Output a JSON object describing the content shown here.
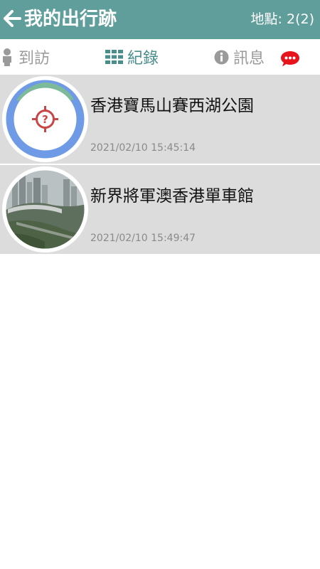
{
  "header": {
    "title": "我的出行跡",
    "count_text": "地點: 2(2)"
  },
  "tabs": [
    {
      "label": "到訪",
      "icon": "person-icon",
      "active": false
    },
    {
      "label": "紀錄",
      "icon": "grid-icon",
      "active": true
    },
    {
      "label": "訊息",
      "icon": "info-icon",
      "active": false
    }
  ],
  "records": [
    {
      "place": "香港寶馬山賽西湖公園",
      "time": "2021/02/10 15:45:14",
      "thumb": "unknown-location-icon"
    },
    {
      "place": "新界將軍澳香港單車館",
      "time": "2021/02/10 15:49:47",
      "thumb": "city-photo"
    }
  ],
  "colors": {
    "header_bg": "#5f9e9b",
    "active_tab": "#4a8e8c",
    "inactive_tab": "#9a9a9a",
    "row_bg": "#dcdcdc",
    "chat_icon": "#e8141b",
    "target_icon": "#c84646"
  }
}
